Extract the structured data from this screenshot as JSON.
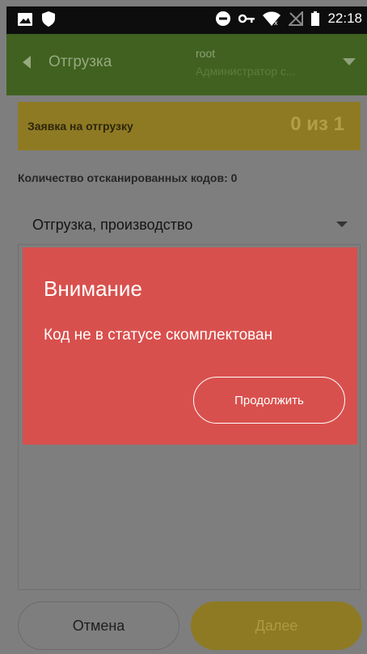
{
  "status_bar": {
    "time": "22:18",
    "icons": [
      "image-icon",
      "shield-icon",
      "dnd-icon",
      "key-icon",
      "wifi-icon",
      "no-sim-icon",
      "battery-icon"
    ]
  },
  "app_bar": {
    "back_icon": "back-arrow-icon",
    "title": "Отгрузка",
    "user": "root",
    "role": "Администратор с...",
    "dropdown_icon": "chevron-down-icon"
  },
  "order_card": {
    "label": "Заявка на отгрузку",
    "count": "0 из 1"
  },
  "scan_count": "Количество отсканированных кодов: 0",
  "select": {
    "value": "Отгрузка, производство"
  },
  "buttons": {
    "cancel": "Отмена",
    "next": "Далее"
  },
  "dialog": {
    "title": "Внимание",
    "message": "Код не в статусе скомплектован",
    "button": "Продолжить"
  },
  "colors": {
    "dialog_bg": "#d8504d",
    "app_bar": "#40611f",
    "accent": "#8e7a23"
  }
}
